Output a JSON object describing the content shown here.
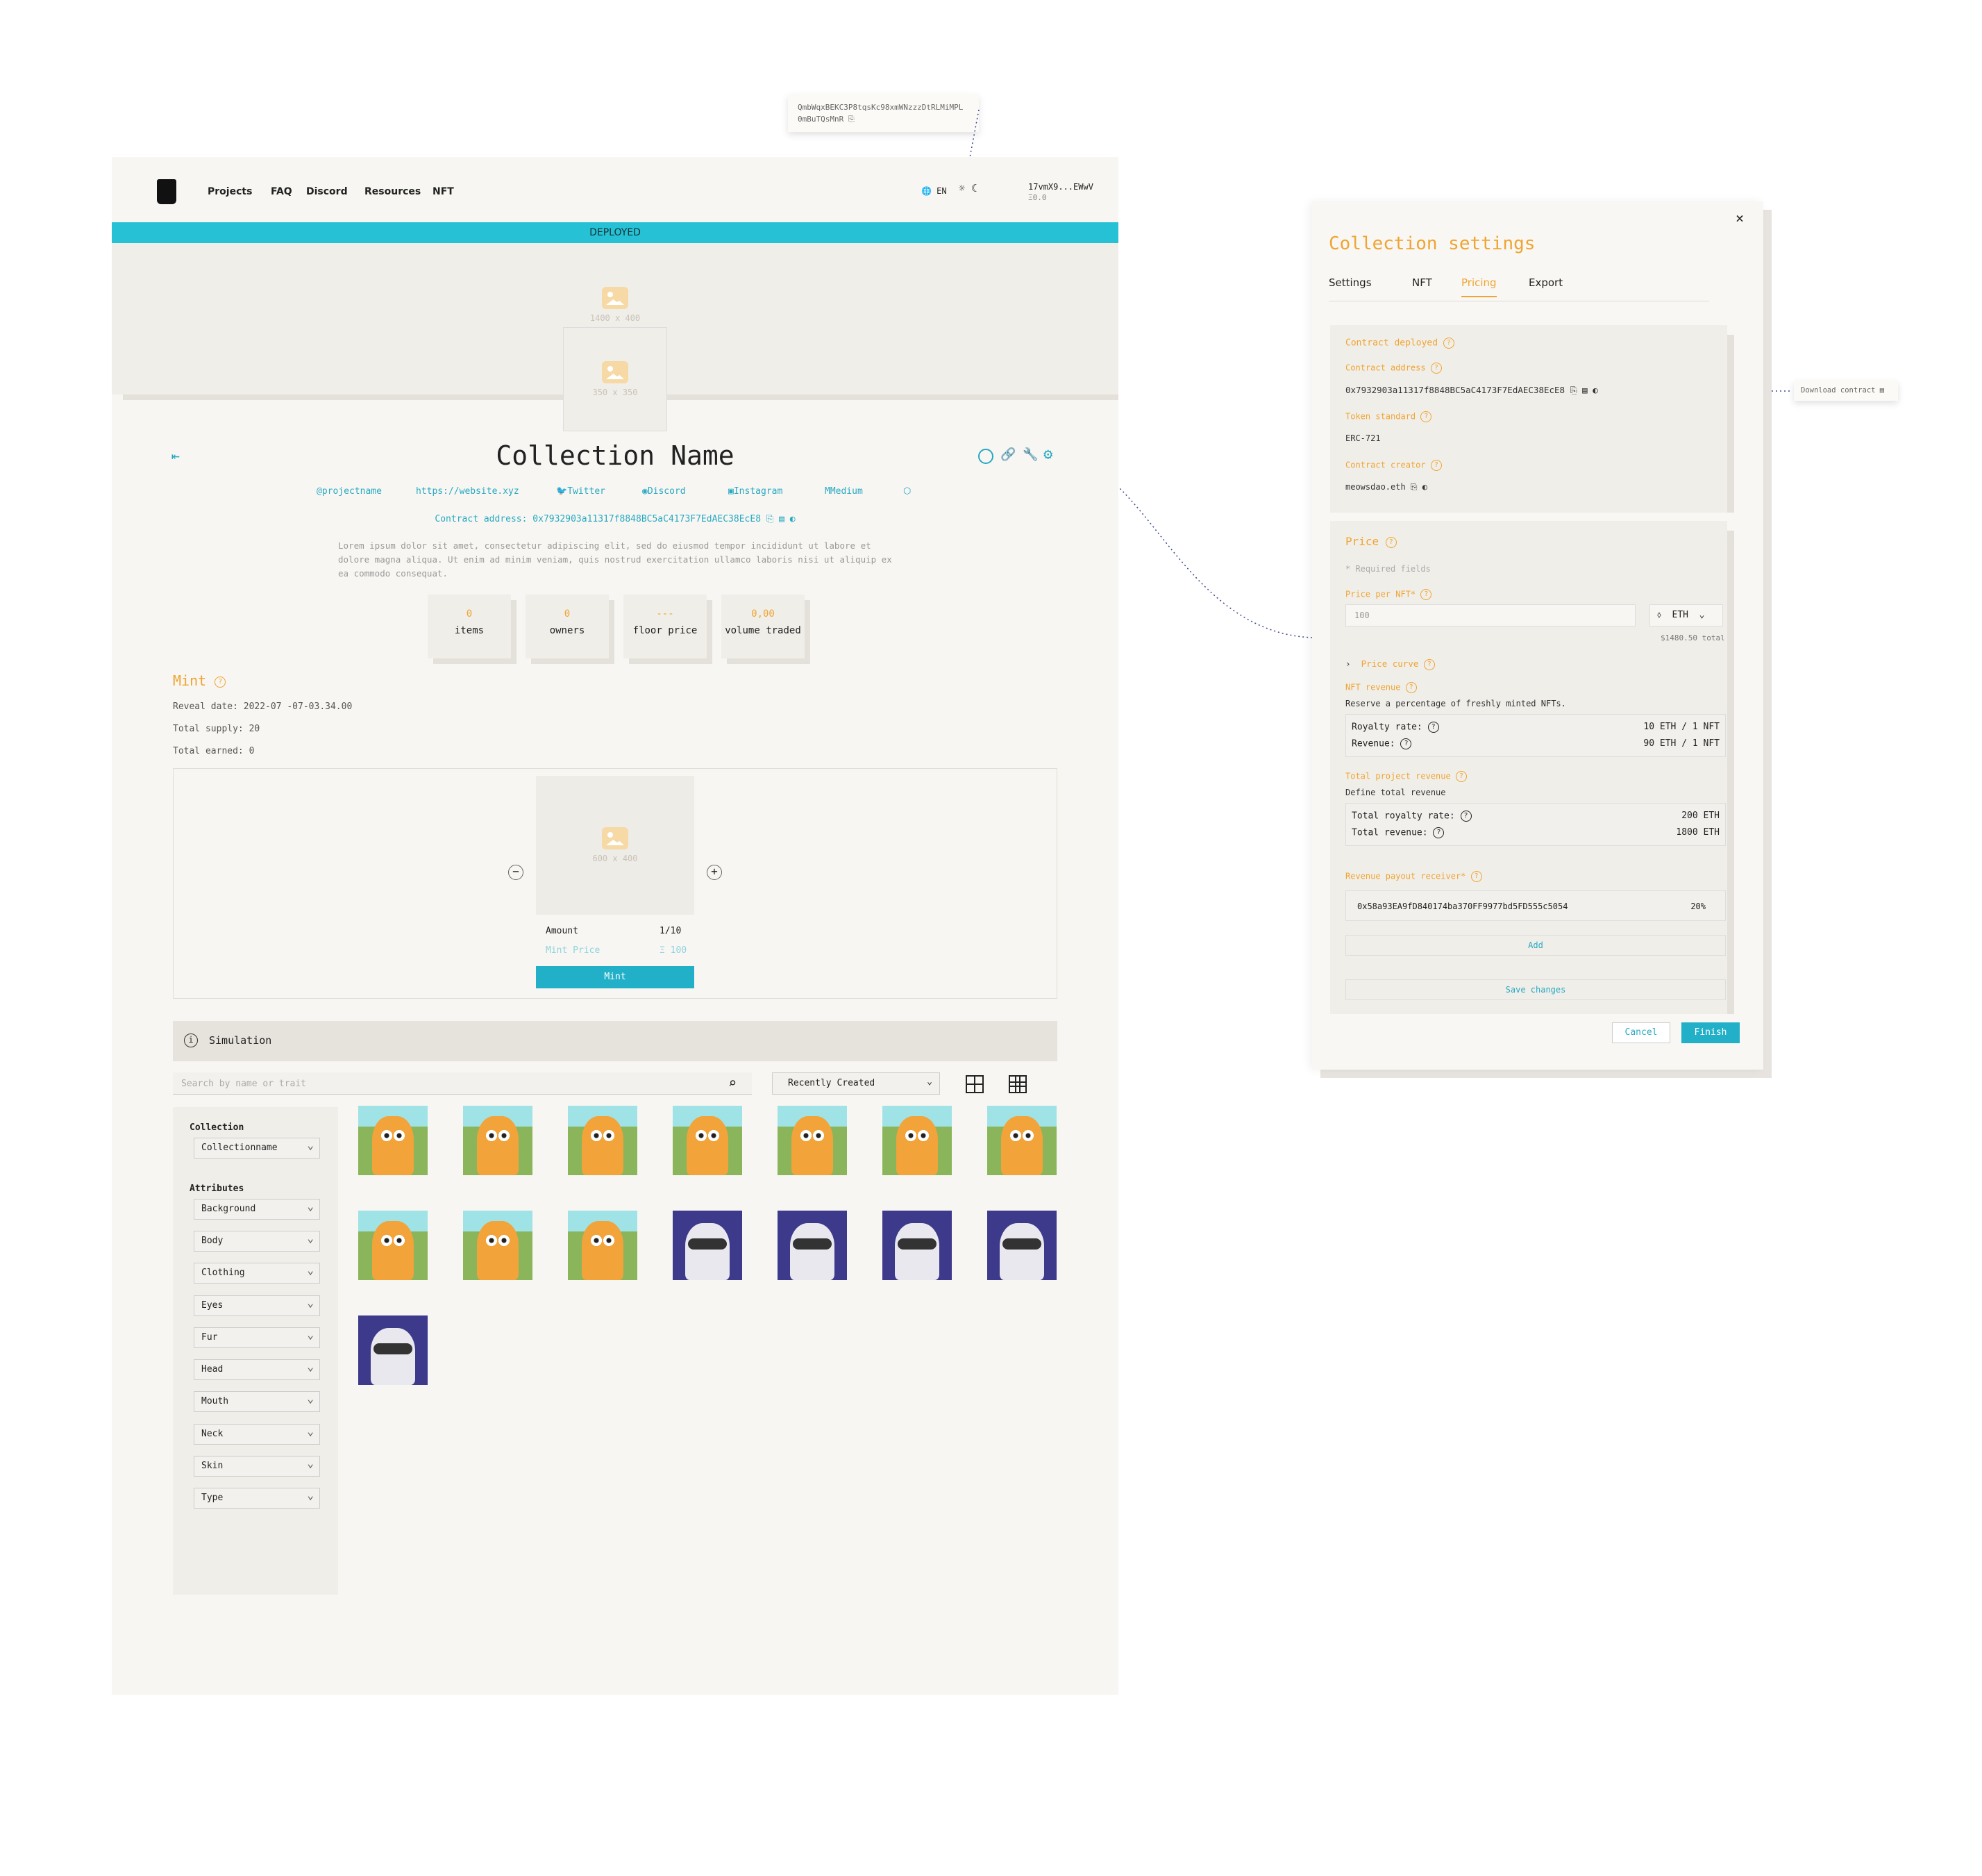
{
  "tooltip_top": {
    "line1": "QmbWqxBEKC3P8tqsKc98xmWNzzzDtRLMiMPL",
    "line2": "0mBuTQsMnR"
  },
  "nav": {
    "links": [
      "Projects",
      "FAQ",
      "Discord",
      "Resources",
      "NFT"
    ],
    "lang": "EN",
    "wallet": "17vmX9...EWwV",
    "balance": "Ξ0.0"
  },
  "banner_status": "DEPLOYED",
  "banner": {
    "size": "1400 x 400",
    "logo_size": "350 x 350"
  },
  "collection": {
    "name": "Collection Name",
    "socials": [
      "@projectname",
      "https://website.xyz",
      "Twitter",
      "Discord",
      "Instagram",
      "Medium"
    ],
    "contract_label": "Contract address:",
    "contract": "0x7932903a11317f8848BC5aC4173F7EdAEC38EcE8",
    "description": "Lorem ipsum dolor sit amet, consectetur adipiscing elit, sed do eiusmod tempor incididunt ut labore et dolore magna aliqua. Ut enim ad minim veniam, quis nostrud exercitation ullamco laboris nisi ut aliquip ex ea commodo consequat."
  },
  "stats": [
    {
      "value": "0",
      "label": "items"
    },
    {
      "value": "0",
      "label": "owners"
    },
    {
      "value": "---",
      "label": "floor price"
    },
    {
      "value": "0,00",
      "label": "volume traded"
    }
  ],
  "mint": {
    "title": "Mint",
    "reveal": "Reveal date: 2022-07 -07-03.34.00",
    "supply": "Total supply: 20",
    "earned": "Total earned: 0",
    "image_size": "600 x 400",
    "amount_label": "Amount",
    "amount": "1/10",
    "price_label": "Mint Price",
    "price": "Ξ 100",
    "button": "Mint"
  },
  "simulation": {
    "title": "Simulation",
    "search_placeholder": "Search by name or trait",
    "sort": "Recently Created"
  },
  "filters": {
    "collection_label": "Collection",
    "collection_value": "Collectionname",
    "attributes_label": "Attributes",
    "attributes": [
      "Background",
      "Body",
      "Clothing",
      "Eyes",
      "Fur",
      "Head",
      "Mouth",
      "Neck",
      "Skin",
      "Type"
    ]
  },
  "grid": [
    "cat",
    "cat",
    "cat",
    "cat",
    "cat",
    "cat",
    "cat",
    "cat",
    "cat",
    "cat",
    "raccoon",
    "raccoon",
    "raccoon",
    "raccoon",
    "raccoon"
  ],
  "settings": {
    "title": "Collection settings",
    "tabs": [
      "Settings",
      "NFT",
      "Pricing",
      "Export"
    ],
    "active_tab": "Pricing",
    "contract_deployed": "Contract deployed",
    "contract_address_label": "Contract address",
    "contract_address": "0x7932903a11317f8848BC5aC4173F7EdAEC38EcE8",
    "token_standard_label": "Token standard",
    "token_standard": "ERC-721",
    "creator_label": "Contract creator",
    "creator": "meowsdao.eth",
    "price_title": "Price",
    "required": "* Required fields",
    "price_per_nft_label": "Price per NFT*",
    "price_value": "100",
    "currency": "ETH",
    "price_total": "$1480.50 total",
    "price_curve": "Price curve",
    "nft_revenue_label": "NFT revenue",
    "nft_revenue_desc": "Reserve a percentage of freshly minted NFTs.",
    "royalty_label": "Royalty rate:",
    "royalty_value": "10 ETH / 1 NFT",
    "revenue_label": "Revenue:",
    "revenue_value": "90 ETH / 1 NFT",
    "total_revenue_title": "Total project revenue",
    "total_revenue_desc": "Define total revenue",
    "total_royalty_label": "Total royalty rate:",
    "total_royalty_value": "200 ETH",
    "total_revenue_label": "Total revenue:",
    "total_revenue_value": "1800 ETH",
    "payout_label": "Revenue payout receiver*",
    "payout_address": "0x58a93EA9fD840174ba370FF9977bd5FD555c5054",
    "payout_percent": "20%",
    "add": "Add",
    "save": "Save changes",
    "cancel": "Cancel",
    "finish": "Finish"
  },
  "download_tip": "Download contract"
}
